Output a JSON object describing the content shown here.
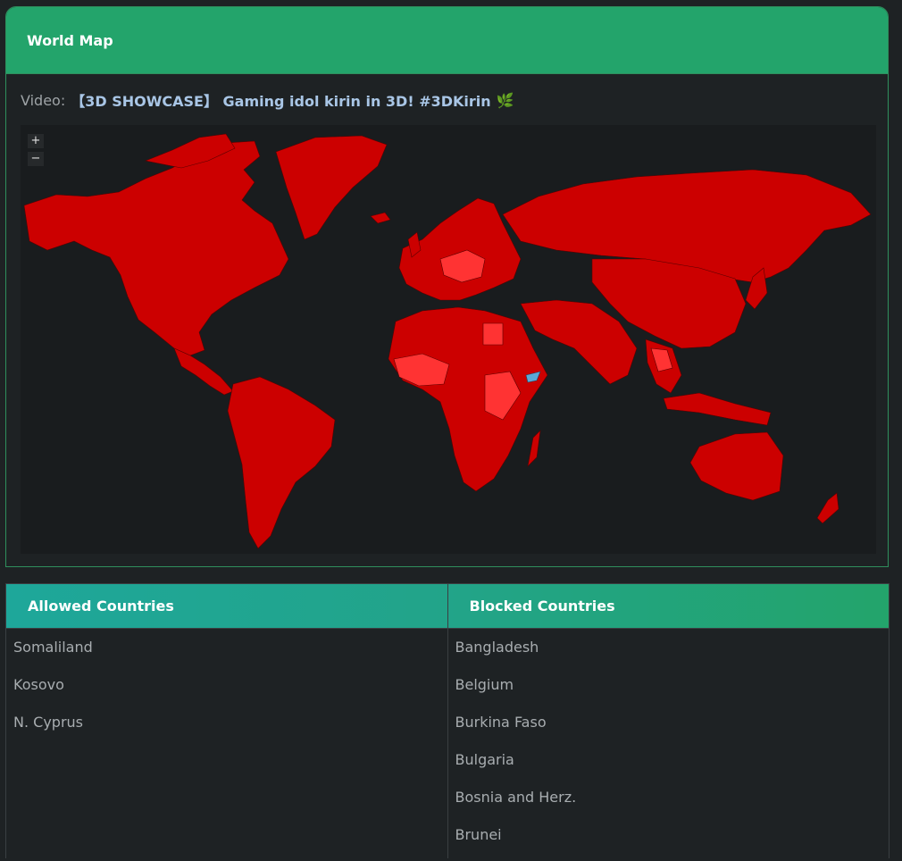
{
  "map_panel": {
    "title": "World Map",
    "video_label": "Video:",
    "video_title": "【3D SHOWCASE】 Gaming idol kirin in 3D! #3DKirin",
    "leaf_icon": "leaf-icon",
    "zoom_in": "+",
    "zoom_out": "−",
    "colors": {
      "blocked": "#cc0000",
      "blocked_light": "#ff3333",
      "allowed": "#5aa9d6",
      "ocean": "#191c1e"
    }
  },
  "allowed": {
    "title": "Allowed Countries",
    "items": [
      "Somaliland",
      "Kosovo",
      "N. Cyprus"
    ]
  },
  "blocked": {
    "title": "Blocked Countries",
    "items": [
      "Bangladesh",
      "Belgium",
      "Burkina Faso",
      "Bulgaria",
      "Bosnia and Herz.",
      "Brunei"
    ]
  }
}
